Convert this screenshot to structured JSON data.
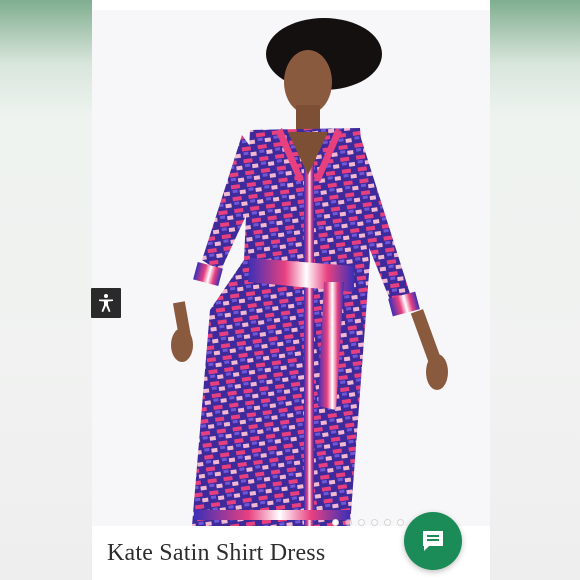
{
  "product": {
    "title": "Kate Satin Shirt Dress"
  },
  "carousel": {
    "total_slides": 6,
    "active_index": 0
  },
  "icons": {
    "accessibility": "accessibility-icon",
    "chat": "chat-bubble-icon"
  },
  "colors": {
    "chat_button": "#1b8b58",
    "accessibility_button": "#2a2a2a",
    "dress_base": "#4a2fa8",
    "dress_accent": "#e8407f"
  }
}
